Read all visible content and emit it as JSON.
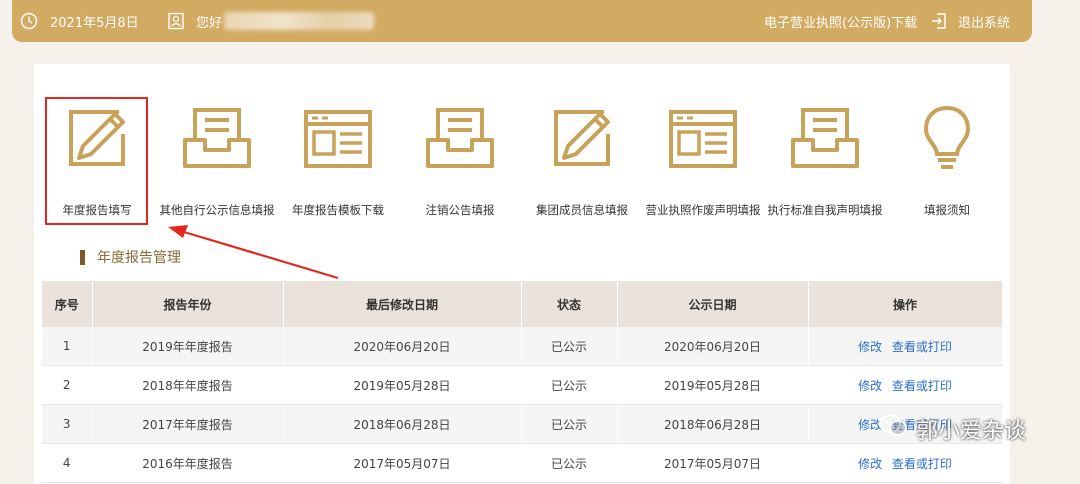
{
  "topbar": {
    "date": "2021年5月8日",
    "greeting": "您好",
    "license_download": "电子营业执照(公示版)下载",
    "logout": "退出系统"
  },
  "toolbar": {
    "items": [
      {
        "label": "年度报告填写",
        "icon": "pencil-frame-icon"
      },
      {
        "label": "其他自行公示信息填报",
        "icon": "inbox-tray-icon"
      },
      {
        "label": "年度报告模板下载",
        "icon": "browser-window-icon"
      },
      {
        "label": "注销公告填报",
        "icon": "inbox-tray-icon"
      },
      {
        "label": "集团成员信息填报",
        "icon": "pencil-frame-icon"
      },
      {
        "label": "营业执照作废声明填报",
        "icon": "browser-window-icon"
      },
      {
        "label": "执行标准自我声明填报",
        "icon": "inbox-tray-icon"
      },
      {
        "label": "填报须知",
        "icon": "lightbulb-icon"
      }
    ]
  },
  "section": {
    "title": "年度报告管理"
  },
  "table": {
    "headers": [
      "序号",
      "报告年份",
      "最后修改日期",
      "状态",
      "公示日期",
      "操作"
    ],
    "rows": [
      {
        "no": "1",
        "year": "2019年年度报告",
        "modified": "2020年06月20日",
        "status": "已公示",
        "published": "2020年06月20日"
      },
      {
        "no": "2",
        "year": "2018年年度报告",
        "modified": "2019年05月28日",
        "status": "已公示",
        "published": "2019年05月28日"
      },
      {
        "no": "3",
        "year": "2017年年度报告",
        "modified": "2018年06月28日",
        "status": "已公示",
        "published": "2018年06月28日"
      },
      {
        "no": "4",
        "year": "2016年年度报告",
        "modified": "2017年05月07日",
        "status": "已公示",
        "published": "2017年05月07日"
      }
    ],
    "actions": {
      "edit": "修改",
      "view": "查看或打印"
    }
  },
  "watermark": {
    "text": "郭小爱杂谈"
  },
  "colors": {
    "accent_gold": "#d3aa62",
    "icon_gold": "#c9a25a",
    "highlight_red": "#e3261f",
    "link_blue": "#2b6fd0"
  }
}
